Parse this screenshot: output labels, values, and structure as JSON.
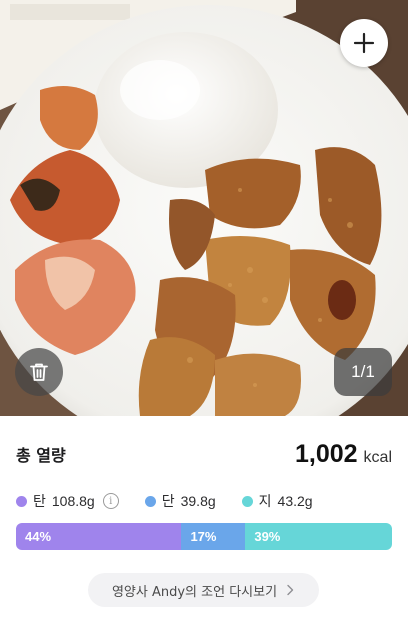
{
  "photo": {
    "counter_current": "1",
    "counter_total": "1",
    "counter_text": "1/1",
    "add_icon": "plus-icon",
    "delete_icon": "trash-icon"
  },
  "nutrition": {
    "total_label": "총 열량",
    "total_value": "1,002",
    "total_unit": "kcal",
    "macros": [
      {
        "label": "탄",
        "amount": "108.8g",
        "color": "#9f84ec",
        "percent_text": "44%",
        "percent": 44
      },
      {
        "label": "단",
        "amount": "39.8g",
        "color": "#6aa6ea",
        "percent_text": "17%",
        "percent": 17
      },
      {
        "label": "지",
        "amount": "43.2g",
        "color": "#66d6d8",
        "percent_text": "39%",
        "percent": 39
      }
    ],
    "info_icon": "info-icon"
  },
  "advice_button": {
    "label": "영양사 Andy의 조언 다시보기",
    "icon": "chevron-right-icon"
  }
}
